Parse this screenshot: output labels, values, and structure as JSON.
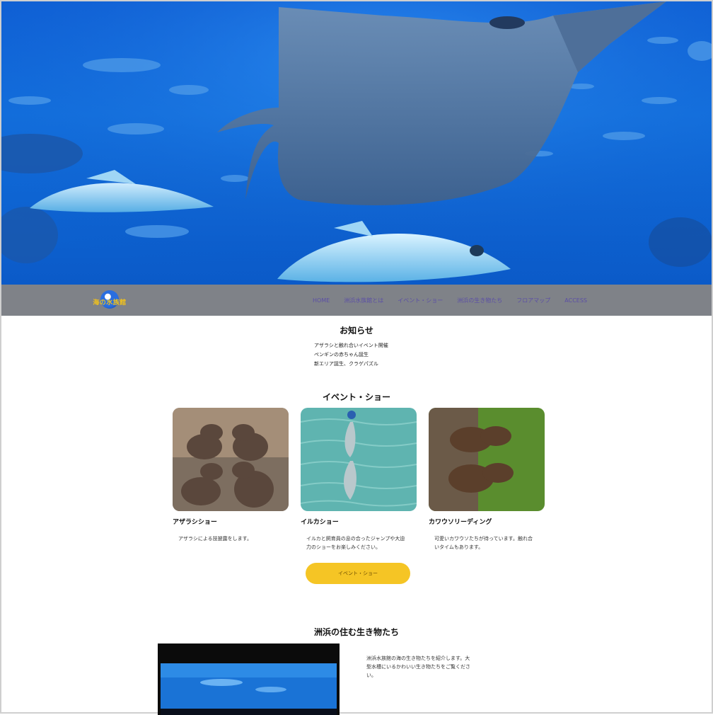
{
  "hero": {
    "alt": "manta-ray-aquarium"
  },
  "logo": {
    "text": "海の水族館"
  },
  "nav": {
    "items": [
      {
        "label": "HOME"
      },
      {
        "label": "洲浜水族館とは"
      },
      {
        "label": "イベント・ショー"
      },
      {
        "label": "洲浜の生き物たち"
      },
      {
        "label": "フロアマップ"
      },
      {
        "label": "ACCESS"
      }
    ]
  },
  "news": {
    "title": "お知らせ",
    "items": [
      "アザラシと触れ合いイベント開催",
      "ペンギンの赤ちゃん誕生",
      "新エリア誕生、クラゲパズル"
    ]
  },
  "events": {
    "title": "イベント・ショー",
    "cards": [
      {
        "title": "アザラシショー",
        "desc": "アザラシによる技披露をします。"
      },
      {
        "title": "イルカショー",
        "desc": "イルカと飼育員の息の合ったジャンプや大迫力のショーをお楽しみください。"
      },
      {
        "title": "カワウソリーディング",
        "desc": "可愛いカワウソたちが待っています。触れ合いタイムもあります。"
      }
    ],
    "button_label": "イベント・ショー"
  },
  "creatures": {
    "title": "洲浜の住む生き物たち",
    "desc": "洲浜水族館の海の生き物たちを紹介します。大型水槽にいるかわいい生き物たちをご覧ください。"
  }
}
